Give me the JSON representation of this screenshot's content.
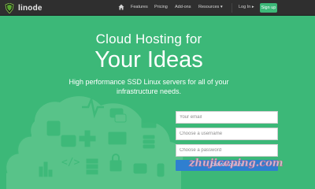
{
  "nav": {
    "logo_text": "linode",
    "links": [
      "Features",
      "Pricing",
      "Add-ons",
      "Resources ▾",
      "Log In ▸"
    ],
    "signup_label": "Sign up"
  },
  "hero": {
    "line1": "Cloud Hosting for",
    "line2": "Your Ideas",
    "subtitle": "High performance SSD Linux servers for all of your infrastructure needs."
  },
  "form": {
    "email_placeholder": "Your email",
    "username_placeholder": "Choose a username",
    "password_placeholder": "Choose a password",
    "submit_label": "Create Account"
  },
  "watermark": {
    "text": "zhujiceping.com"
  },
  "colors": {
    "background": "#3cb878",
    "nav_bg": "#2f2f2f",
    "signup_bg": "#3cb878",
    "button_bg": "#2f7fd0"
  },
  "icons": [
    "linode-logo-icon",
    "home-icon",
    "cloud-illustration"
  ]
}
